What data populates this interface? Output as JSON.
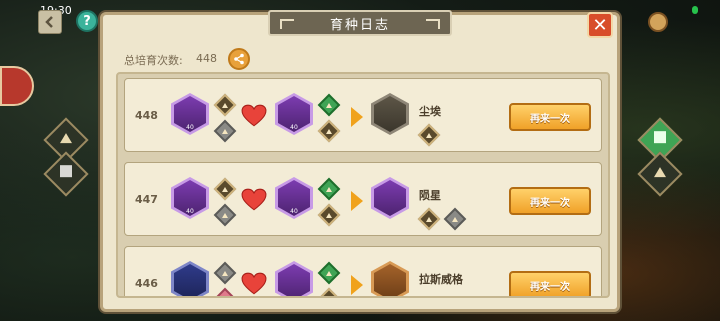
{
  "status": {
    "time": "19:30"
  },
  "header": {
    "title": "育种日志",
    "close_label": "✕",
    "help_label": "?"
  },
  "summary": {
    "total_label": "总培育次数:",
    "total_value": "448"
  },
  "rows": [
    {
      "number": "448",
      "parent1_level": "40",
      "parent2_level": "40",
      "result_name": "尘埃",
      "button_label": "再来一次"
    },
    {
      "number": "447",
      "parent1_level": "40",
      "parent2_level": "40",
      "result_name": "陨星",
      "button_label": "再来一次"
    },
    {
      "number": "446",
      "parent1_level": "",
      "parent2_level": "",
      "result_name": "拉斯威格",
      "button_label": "再来一次"
    }
  ],
  "colors": {
    "accent": "#f0a128",
    "panel_bg": "#eee6cd",
    "close_red": "#d84d2a",
    "hex_purple": "#8b3fbf",
    "hex_dark": "#4a4338"
  },
  "icons": {
    "back": "chevron-left-icon",
    "help": "question-icon",
    "close": "close-icon",
    "share": "share-icon",
    "heart": "heart-icon",
    "arrow": "play-arrow-icon",
    "element": "mountain-icon"
  }
}
